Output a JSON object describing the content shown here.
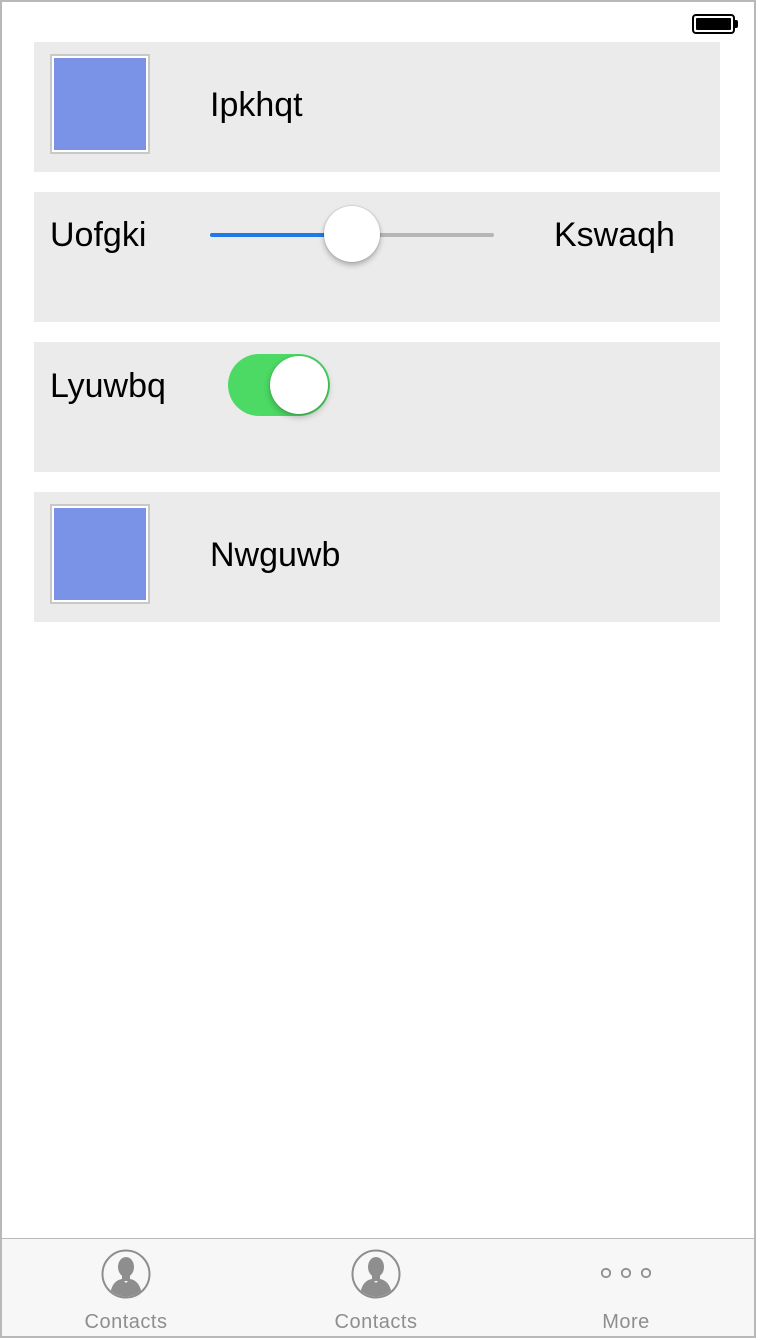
{
  "status_bar": {
    "battery_icon": "battery-full-icon"
  },
  "rows": [
    {
      "type": "image-row",
      "label": "Ipkhqt",
      "swatch_color": "#7b93e6"
    },
    {
      "type": "slider-row",
      "left_label": "Uofgki",
      "right_label": "Kswaqh",
      "value": 0.5,
      "accent": "#1f7ae8"
    },
    {
      "type": "switch-row",
      "label": "Lyuwbq",
      "on": true,
      "accent": "#4cd964"
    },
    {
      "type": "image-row",
      "label": "Nwguwb",
      "swatch_color": "#7b93e6"
    }
  ],
  "tabbar": {
    "tabs": [
      {
        "label": "Contacts",
        "icon": "contact-icon"
      },
      {
        "label": "Contacts",
        "icon": "contact-icon"
      },
      {
        "label": "More",
        "icon": "more-icon"
      }
    ]
  }
}
